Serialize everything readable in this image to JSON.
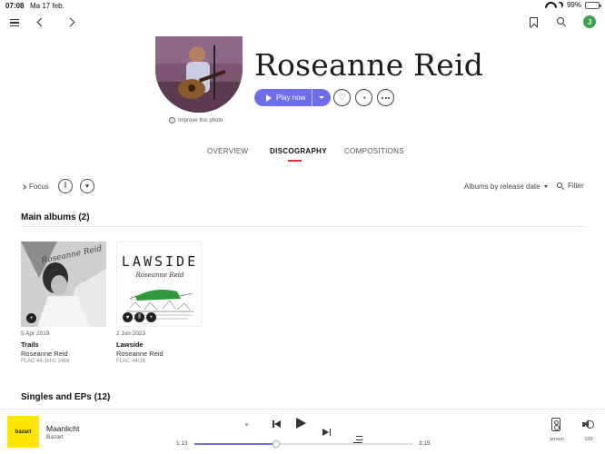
{
  "status_bar": {
    "time": "07:08",
    "date": "Ma 17 feb.",
    "battery": "99%",
    "battery_level": 0.99
  },
  "artist": {
    "name": "Roseanne Reid",
    "play_label": "Play now",
    "improve_photo": "Improve this photo"
  },
  "tabs": [
    {
      "label": "OVERVIEW",
      "active": false
    },
    {
      "label": "DISCOGRAPHY",
      "active": true
    },
    {
      "label": "COMPOSITIONS",
      "active": false
    }
  ],
  "filters": {
    "focus_label": "Focus",
    "sort_label": "Albums by release date",
    "filter_label": "Filter"
  },
  "sections": {
    "main_albums": "Main albums (2)",
    "singles": "Singles and EPs (12)"
  },
  "albums": [
    {
      "date": "5 Apr 2019",
      "title": "Trails",
      "artist": "Roseanne Reid",
      "quality": "FLAC 44.1kHz 24bit",
      "cover_signature": "Roseanne Reid"
    },
    {
      "date": "2 Jun 2023",
      "title": "Lawside",
      "artist": "Roseanne Reid",
      "quality": "FLAC 44/16",
      "cover_title": "LAWSIDE",
      "cover_signature": "Roseanne Reid"
    }
  ],
  "player": {
    "track_title": "Maanlicht",
    "track_artist": "Bazart",
    "art_label": "bazart",
    "current_time": "1:13",
    "total_time": "3:15",
    "progress": 0.375,
    "device_label": "jeroen",
    "volume": "100"
  },
  "colors": {
    "accent": "#6d6dea",
    "tab_indicator": "#e0323a",
    "user_avatar": "#3aa548",
    "now_playing_art": "#ffe500"
  },
  "user": {
    "initial": "J"
  }
}
